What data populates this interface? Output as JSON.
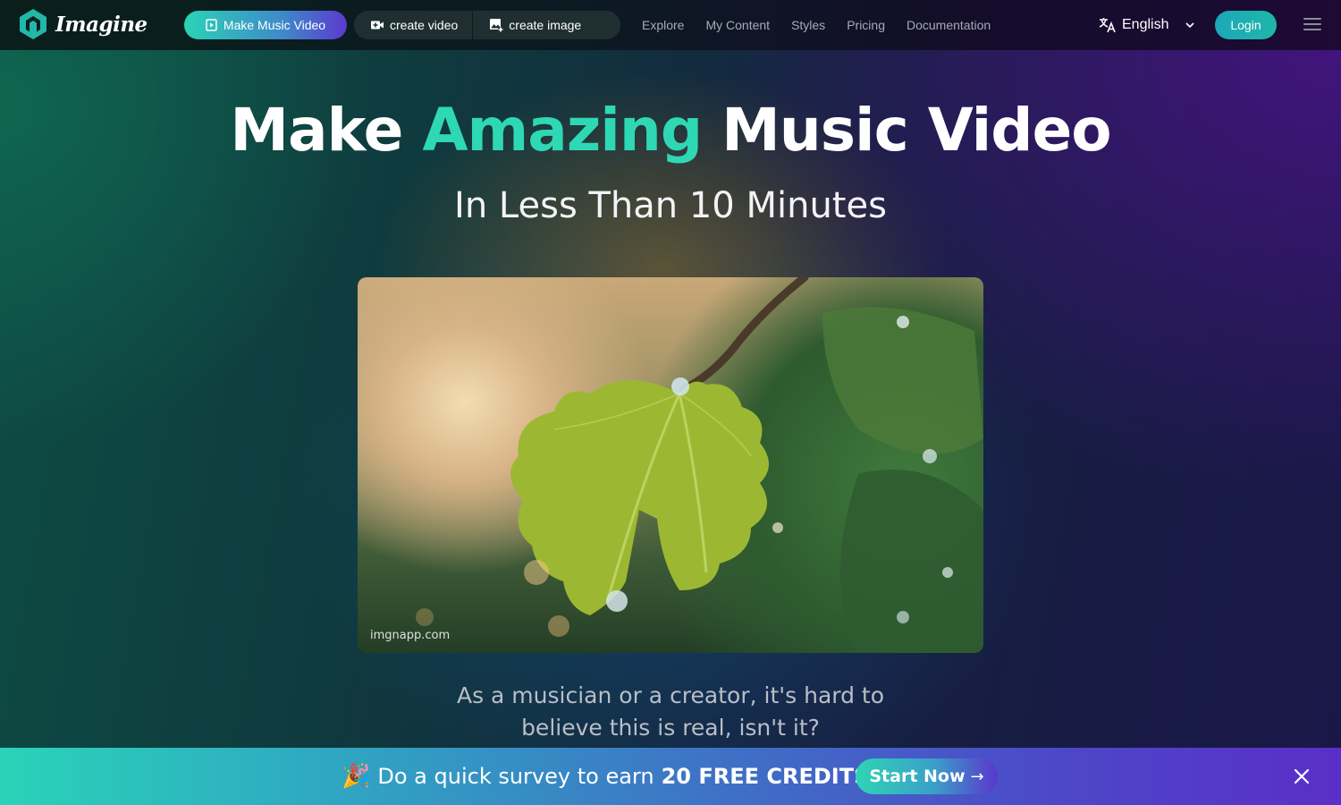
{
  "header": {
    "logo_text": "Imagine",
    "make_music_video_label": "Make Music Video",
    "create_video_label": "create video",
    "create_image_label": "create image",
    "nav": [
      "Explore",
      "My Content",
      "Styles",
      "Pricing",
      "Documentation"
    ],
    "language": "English",
    "login_label": "Login",
    "icons": {
      "logo": "hexagon-logo-icon",
      "make_music_video": "video-file-icon",
      "create_video": "video-camera-icon",
      "create_image": "image-add-icon",
      "language": "translate-icon",
      "language_dropdown": "chevron-down-icon",
      "menu": "hamburger-menu-icon"
    }
  },
  "hero": {
    "title_part1": "Make",
    "title_accent": "Amazing",
    "title_part2": "Music Video",
    "subtitle": "In Less Than 10 Minutes",
    "media_watermark": "imgnapp.com",
    "tagline_line1": "As a musician or a creator, it's hard to",
    "tagline_line2": "believe this is real, isn't it?"
  },
  "banner": {
    "emoji": "🎉",
    "text": "Do a quick survey to earn",
    "highlight": "20 FREE CREDITS",
    "cta_label": "Start Now",
    "cta_arrow": "→",
    "close_icon": "close-icon"
  },
  "colors": {
    "accent_teal": "#2fd8b4",
    "login_button": "#1ba8b8",
    "banner_start": "#2ad3b8",
    "banner_end": "#5a2ec8",
    "nav_text": "#a7abb4"
  }
}
